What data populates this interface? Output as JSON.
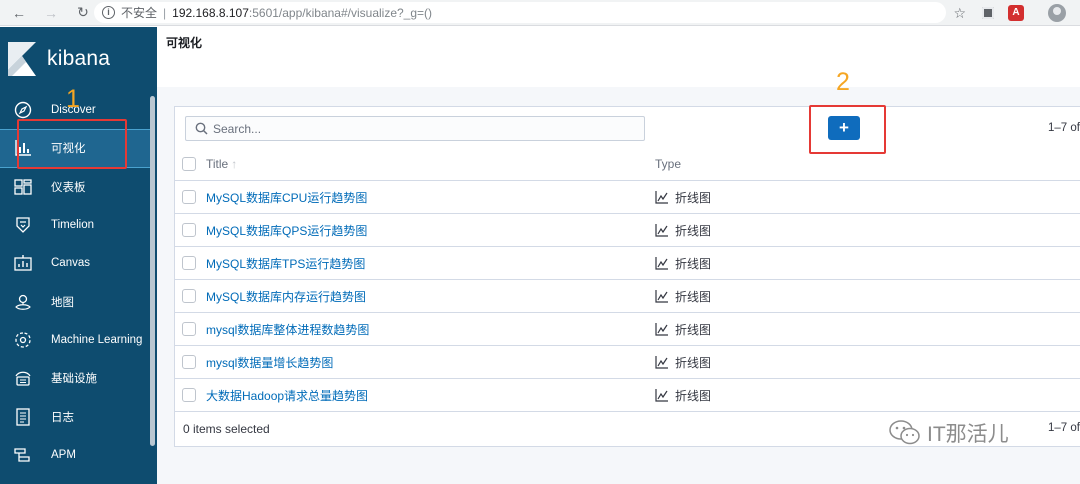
{
  "browser": {
    "security_label": "不安全",
    "url_host": "192.168.8.107",
    "url_path": ":5601/app/kibana#/visualize?_g=()"
  },
  "sidebar": {
    "logo_text": "kibana",
    "items": [
      {
        "label": "Discover",
        "icon": "compass-icon"
      },
      {
        "label": "可视化",
        "icon": "visualize-icon",
        "active": true
      },
      {
        "label": "仪表板",
        "icon": "dashboard-icon"
      },
      {
        "label": "Timelion",
        "icon": "timelion-icon"
      },
      {
        "label": "Canvas",
        "icon": "canvas-icon"
      },
      {
        "label": "地图",
        "icon": "maps-icon"
      },
      {
        "label": "Machine Learning",
        "icon": "machine-learning-icon"
      },
      {
        "label": "基础设施",
        "icon": "infrastructure-icon"
      },
      {
        "label": "日志",
        "icon": "logs-icon"
      },
      {
        "label": "APM",
        "icon": "apm-icon"
      }
    ]
  },
  "main": {
    "page_title": "可视化",
    "search_placeholder": "Search...",
    "add_button": "+",
    "pagination": "1–7 of",
    "table": {
      "columns": {
        "title": "Title",
        "sort_indicator": "↑",
        "type": "Type"
      },
      "rows": [
        {
          "title": "MySQL数据库CPU运行趋势图",
          "type": "折线图"
        },
        {
          "title": "MySQL数据库QPS运行趋势图",
          "type": "折线图"
        },
        {
          "title": "MySQL数据库TPS运行趋势图",
          "type": "折线图"
        },
        {
          "title": "MySQL数据库内存运行趋势图",
          "type": "折线图"
        },
        {
          "title": "mysql数据库整体进程数趋势图",
          "type": "折线图"
        },
        {
          "title": "mysql数据量增长趋势图",
          "type": "折线图"
        },
        {
          "title": "大数据Hadoop请求总量趋势图",
          "type": "折线图"
        }
      ]
    },
    "selection_status": "0 items selected",
    "footer_pagination": "1–7 of"
  },
  "annotations": {
    "marker_1": "1",
    "marker_2": "2",
    "color_box": "#e53935",
    "color_number": "#f5a623"
  },
  "watermark": {
    "text": "IT那活儿"
  },
  "colors": {
    "sidebar_bg": "#0e4c6f",
    "sidebar_active": "#1f6690",
    "link": "#006bb8",
    "primary_button": "#0f6cbd"
  }
}
